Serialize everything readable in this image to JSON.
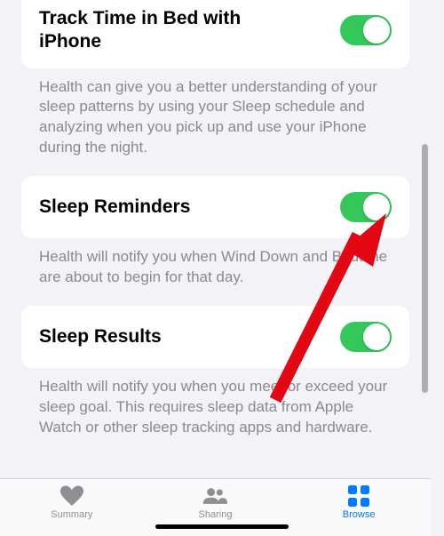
{
  "settings": [
    {
      "title": "Track Time in Bed with iPhone",
      "description": "Health can give you a better understanding of your sleep patterns by using your Sleep schedule and analyzing when you pick up and use your iPhone during the night.",
      "enabled": true
    },
    {
      "title": "Sleep Reminders",
      "description": "Health will notify you when Wind Down and Bedtime are about to begin for that day.",
      "enabled": true
    },
    {
      "title": "Sleep Results",
      "description": "Health will notify you when you meet or exceed your sleep goal. This requires sleep data from Apple Watch or other sleep tracking apps and hardware.",
      "enabled": true
    }
  ],
  "tabbar": {
    "items": [
      {
        "label": "Summary",
        "icon": "heart-icon",
        "active": false
      },
      {
        "label": "Sharing",
        "icon": "people-icon",
        "active": false
      },
      {
        "label": "Browse",
        "icon": "grid-icon",
        "active": true
      }
    ]
  },
  "annotation": {
    "arrow_target": "sleep-reminders-toggle"
  }
}
